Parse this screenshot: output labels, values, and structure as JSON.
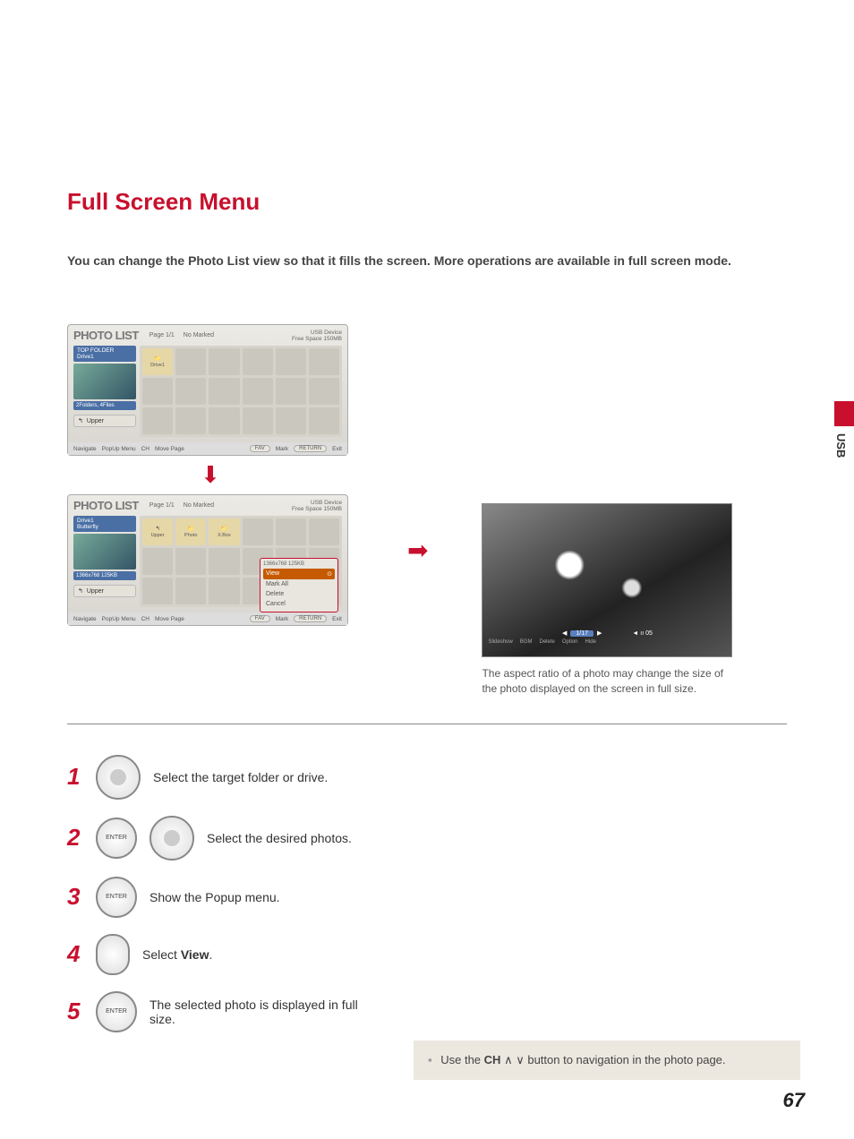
{
  "section_tab": "USB",
  "page_number": "67",
  "heading": "Full Screen Menu",
  "intro": "You can change the Photo List view so that it fills the screen. More operations are available in full screen mode.",
  "panel1": {
    "title": "PHOTO LIST",
    "page": "Page 1/1",
    "marked": "No Marked",
    "usb": "USB Device",
    "free": "Free Space 150MB",
    "top_folder": "TOP FOLDER",
    "drive": "Drive1",
    "side_info": "2Folders, 4Files",
    "upper": "Upper",
    "cell_label": "Drive1",
    "footer": {
      "nav": "Navigate",
      "pop": "PopUp Menu",
      "ch": "CH",
      "move": "Move Page",
      "fav": "FAV",
      "mark": "Mark",
      "ret": "RETURN",
      "exit": "Exit"
    }
  },
  "panel2": {
    "title": "PHOTO LIST",
    "page": "Page 1/1",
    "marked": "No Marked",
    "usb": "USB Device",
    "free": "Free Space 150MB",
    "drive": "Drive1",
    "file": "Butterfly",
    "dim": "1366x768 125KB",
    "upper": "Upper",
    "cells": [
      "Upper",
      "Photo",
      "X.Box"
    ],
    "popup_head": "1366x768\n125KB",
    "popup": {
      "view": "View",
      "markall": "Mark All",
      "delete": "Delete",
      "cancel": "Cancel"
    },
    "footer": {
      "nav": "Navigate",
      "pop": "PopUp Menu",
      "ch": "CH",
      "move": "Move Page",
      "fav": "FAV",
      "mark": "Mark",
      "ret": "RETURN",
      "exit": "Exit"
    }
  },
  "full_preview": {
    "counter": "1/17",
    "vol": "◄ ıı 05",
    "menu": [
      "Slideshow",
      "BGM",
      "Delete",
      "Option",
      "Hide"
    ],
    "caption": "The aspect ratio of a photo may change the size of the photo displayed on the screen in full size."
  },
  "steps": [
    {
      "n": "1",
      "text": "Select the target folder or drive."
    },
    {
      "n": "2",
      "text": "Select the desired photos.",
      "btn": "ENTER"
    },
    {
      "n": "3",
      "text": "Show the Popup menu.",
      "btn": "ENTER"
    },
    {
      "n": "4",
      "text_pre": "Select ",
      "text_bold": "View",
      "text_post": "."
    },
    {
      "n": "5",
      "text": "The selected photo is displayed in full size.",
      "btn": "ENTER"
    }
  ],
  "note": {
    "pre": "Use the ",
    "ch": "CH",
    "post": " button to navigation in the photo page."
  }
}
